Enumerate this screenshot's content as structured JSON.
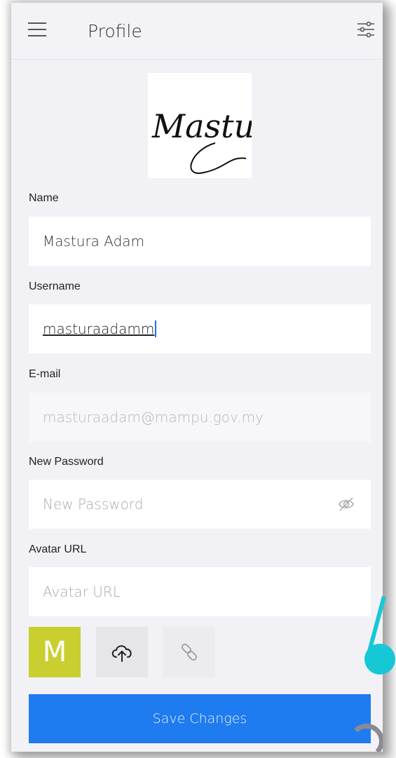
{
  "header": {
    "title": "Profile"
  },
  "avatar": {
    "signature_text": "Mastura"
  },
  "form": {
    "name": {
      "label": "Name",
      "value": "Mastura Adam"
    },
    "username": {
      "label": "Username",
      "value": "masturaadamm"
    },
    "email": {
      "label": "E-mail",
      "value": "masturaadam@mampu.gov.my"
    },
    "password": {
      "label": "New Password",
      "placeholder": "New Password"
    },
    "avatar_url": {
      "label": "Avatar URL",
      "placeholder": "Avatar URL"
    }
  },
  "avatar_options": {
    "initial": "M",
    "initial_color": "#c9cf2f"
  },
  "actions": {
    "save_label": "Save Changes",
    "accent": "#1e7bf0"
  }
}
